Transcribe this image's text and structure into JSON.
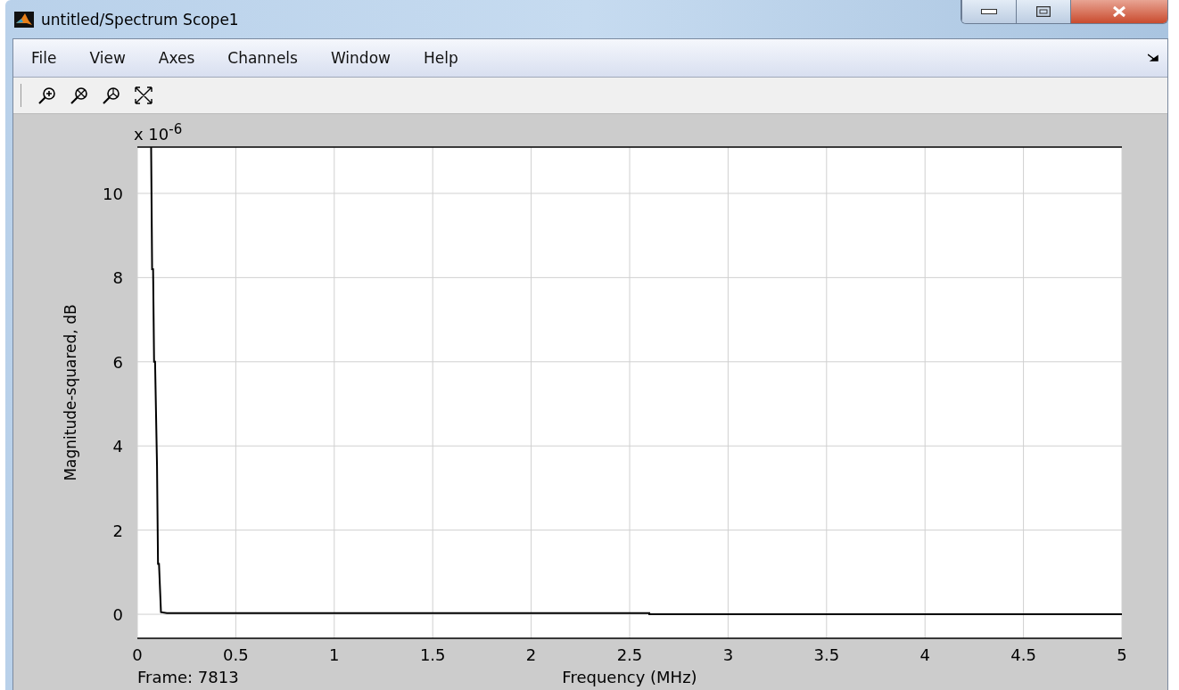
{
  "window": {
    "title": "untitled/Spectrum Scope1"
  },
  "menu": [
    {
      "label": "File"
    },
    {
      "label": "View"
    },
    {
      "label": "Axes"
    },
    {
      "label": "Channels"
    },
    {
      "label": "Window"
    },
    {
      "label": "Help"
    }
  ],
  "toolbar": [
    {
      "kind": "zoom-in"
    },
    {
      "kind": "zoom-x"
    },
    {
      "kind": "zoom-y"
    },
    {
      "kind": "autoscale"
    }
  ],
  "plot": {
    "exponent": "x 10$^{-6}$",
    "frame": "Frame: 7813",
    "chart_data": {
      "type": "line",
      "xlabel": "Frequency (MHz)",
      "ylabel": "Magnitude-squared, dB",
      "xlim": [
        0,
        5
      ],
      "ylim": [
        -0.57,
        11.1
      ],
      "grid": true,
      "xticks": [
        0,
        0.5,
        1,
        1.5,
        2,
        2.5,
        3,
        3.5,
        4,
        4.5,
        5
      ],
      "yticks": [
        0,
        2,
        4,
        6,
        8,
        10
      ],
      "series": [
        {
          "color": "#000000",
          "x": [
            0.07,
            0.075,
            0.08,
            0.085,
            0.09,
            0.1,
            0.105,
            0.11,
            0.12,
            0.15,
            2.6,
            2.6,
            5
          ],
          "values": [
            11.1,
            8.2,
            8.2,
            6,
            6,
            3.5,
            1.2,
            1.2,
            0.05,
            0.03,
            0.03,
            0,
            0
          ]
        }
      ]
    }
  }
}
